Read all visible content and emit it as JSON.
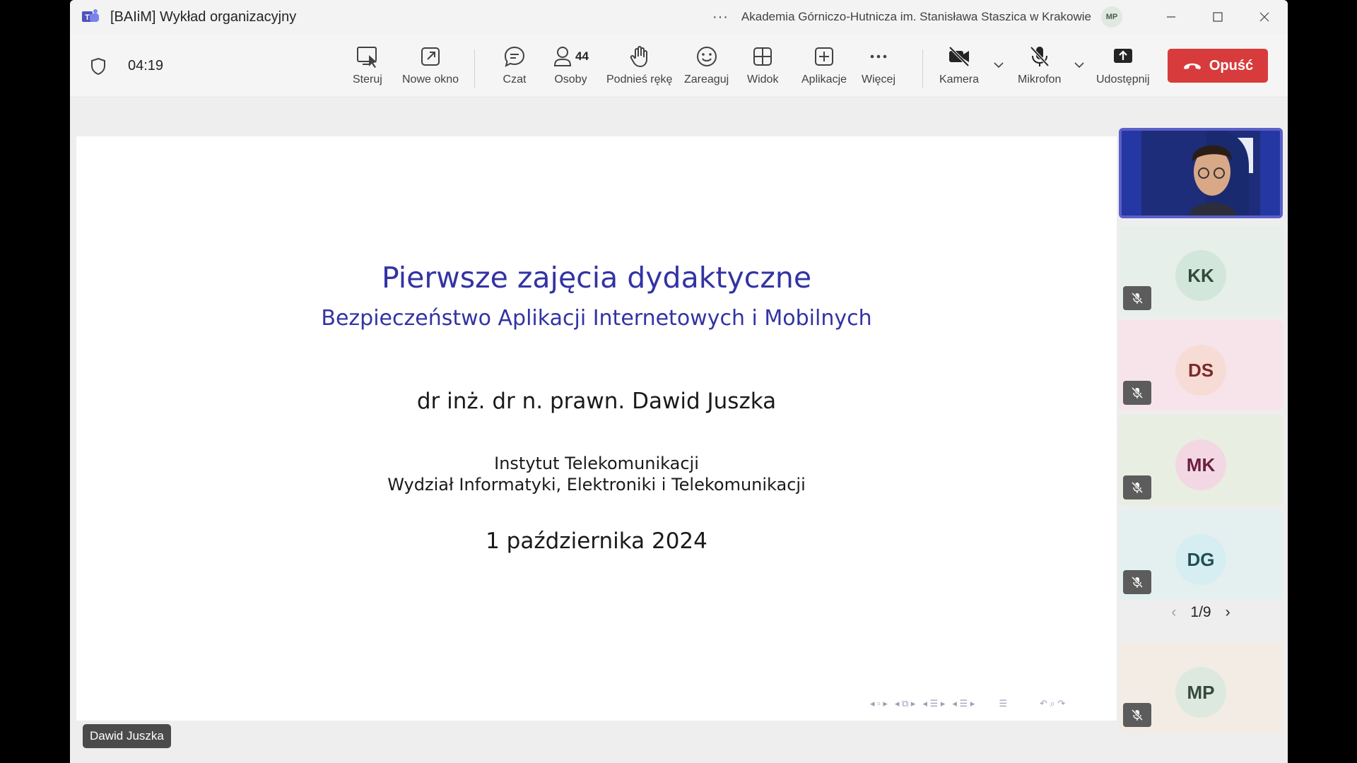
{
  "titlebar": {
    "title": "[BAIiM] Wykład organizacyjny",
    "org": "Akademia Górniczo-Hutnicza im. Stanisława Staszica w Krakowie",
    "user_initials": "MP"
  },
  "toolbar": {
    "timer": "04:19",
    "items": {
      "steruj": "Steruj",
      "nowe_okno": "Nowe okno",
      "czat": "Czat",
      "osoby": "Osoby",
      "osoby_count": "44",
      "podnies": "Podnieś rękę",
      "zareaguj": "Zareaguj",
      "widok": "Widok",
      "aplikacje": "Aplikacje",
      "wiecej": "Więcej",
      "kamera": "Kamera",
      "mikrofon": "Mikrofon",
      "udostepnij": "Udostępnij"
    },
    "leave": "Opuść"
  },
  "slide": {
    "title": "Pierwsze zajęcia dydaktyczne",
    "subtitle": "Bezpieczeństwo Aplikacji Internetowych i Mobilnych",
    "author": "dr inż. dr n. prawn. Dawid Juszka",
    "institute": "Instytut Telekomunikacji",
    "faculty": "Wydział Informatyki, Elektroniki i Telekomunikacji",
    "date": "1 października 2024"
  },
  "presenter_name": "Dawid Juszka",
  "participants": [
    {
      "initials": "KK",
      "bg": "#e6efe9",
      "circle": "#d3e6db",
      "color": "#2f4a3a"
    },
    {
      "initials": "DS",
      "bg": "#f6e4ea",
      "circle": "#f7dcd6",
      "color": "#7a2a2a"
    },
    {
      "initials": "MK",
      "bg": "#e8eee2",
      "circle": "#f3d8e3",
      "color": "#6b2040"
    },
    {
      "initials": "DG",
      "bg": "#e4f0ef",
      "circle": "#d6eef1",
      "color": "#1f4f5a"
    }
  ],
  "pager": "1/9",
  "last_participant": {
    "initials": "MP",
    "bg": "#f2ece4",
    "circle": "#dde9df",
    "color": "#344a3a"
  },
  "colors": {
    "accent": "#5b5fc7",
    "leave": "#d83b3b",
    "slide_title": "#3333a3"
  }
}
